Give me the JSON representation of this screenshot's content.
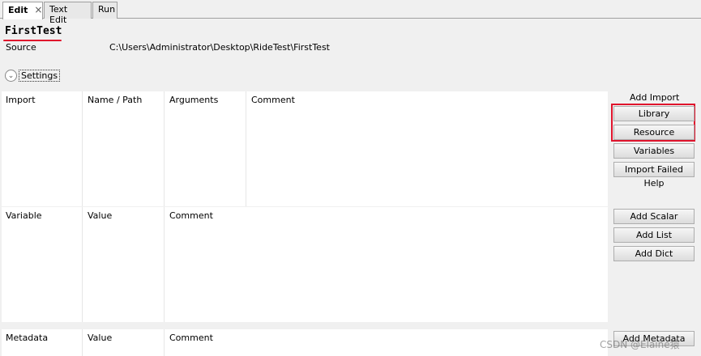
{
  "tabs": [
    {
      "label": "Edit",
      "active": true,
      "close_glyph": "×"
    },
    {
      "label": "Text Edit",
      "active": false
    },
    {
      "label": "Run",
      "active": false
    }
  ],
  "header": {
    "title": "FirstTest",
    "source_label": "Source",
    "source_value": "C:\\Users\\Administrator\\Desktop\\RideTest\\FirstTest"
  },
  "settings": {
    "label": "Settings",
    "icon": "chevron-down-icon"
  },
  "imports": {
    "headers": [
      "Import",
      "Name / Path",
      "Arguments",
      "Comment"
    ],
    "panel_title": "Add Import",
    "buttons": [
      "Library",
      "Resource",
      "Variables",
      "Import Failed Help"
    ]
  },
  "variables": {
    "headers": [
      "Variable",
      "Value",
      "Comment"
    ],
    "buttons": [
      "Add Scalar",
      "Add List",
      "Add Dict"
    ]
  },
  "metadata": {
    "headers": [
      "Metadata",
      "Value",
      "Comment"
    ],
    "buttons": [
      "Add Metadata"
    ]
  },
  "watermark": "CSDN @Elaine猿",
  "colors": {
    "highlight": "#e0142c",
    "table_bg": "#ffffff",
    "window_bg": "#f0f0f0"
  }
}
